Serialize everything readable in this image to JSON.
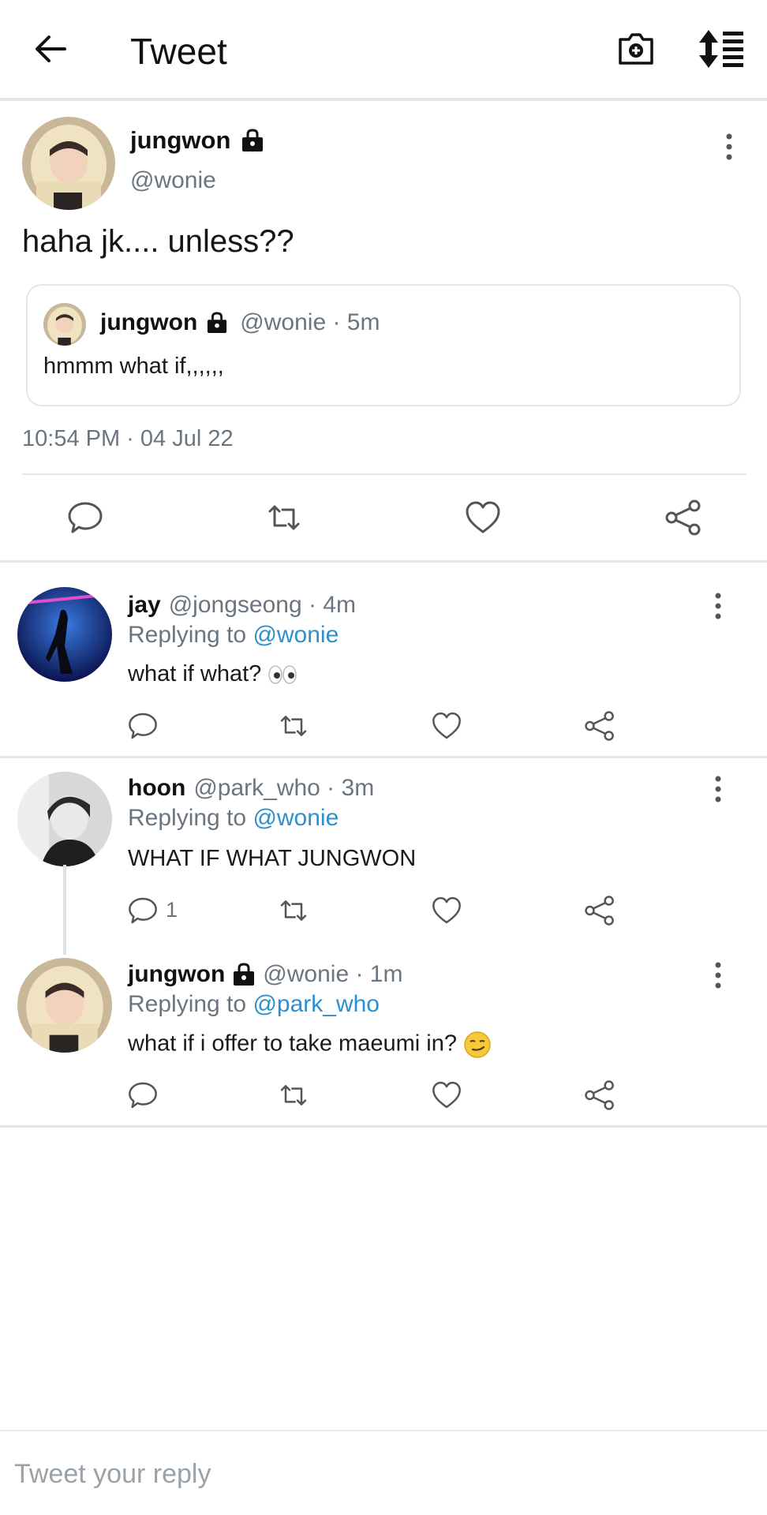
{
  "header": {
    "title": "Tweet",
    "back_icon": "arrow-left-icon",
    "camera_icon": "camera-add-icon",
    "sort_icon": "sort-list-icon"
  },
  "main_tweet": {
    "name": "jungwon",
    "handle": "@wonie",
    "text": "haha jk.... unless??",
    "timestamp": "10:54 PM · 04 Jul 22",
    "quoted": {
      "name": "jungwon",
      "meta": "@wonie · 5m",
      "text": "hmmm what if,,,,,,"
    }
  },
  "replies": [
    {
      "name": "jay",
      "meta": "@jongseong · 4m",
      "replying_prefix": "Replying to",
      "replying_to": "@wonie",
      "text": "what if what?",
      "emoji": "eyes"
    },
    {
      "name": "hoon",
      "meta": "@park_who · 3m",
      "replying_prefix": "Replying to",
      "replying_to": "@wonie",
      "text": "WHAT IF WHAT JUNGWON",
      "reply_count": "1"
    },
    {
      "name": "jungwon",
      "meta": "@wonie · 1m",
      "replying_prefix": "Replying to",
      "replying_to": "@park_who",
      "text": "what if i offer to take maeumi in?",
      "emoji": "smirk"
    }
  ],
  "reply_box": {
    "placeholder": "Tweet your reply"
  },
  "colors": {
    "accent": "#2a90cf",
    "muted": "#6b7580",
    "divider": "#e3e6e8"
  }
}
